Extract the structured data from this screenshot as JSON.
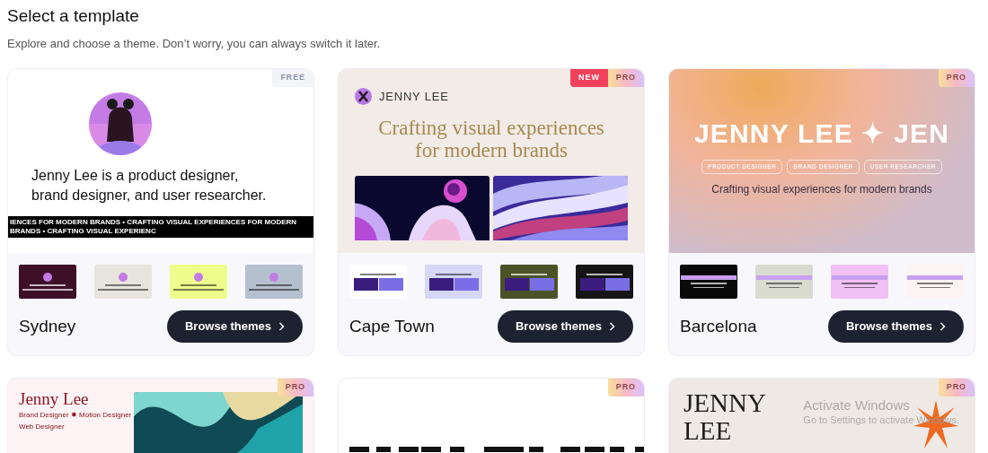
{
  "header": {
    "title": "Select a template",
    "subtitle": "Explore and choose a theme. Don’t worry, you can always switch it later."
  },
  "templates": [
    {
      "name": "Sydney",
      "button": "Browse themes",
      "badges": [
        {
          "label": "FREE",
          "kind": "free"
        }
      ],
      "preview": {
        "kind": "avatar_bio",
        "bio": "Jenny Lee is a product designer, brand designer, and user researcher.",
        "ticker": "IENCES FOR MODERN BRANDS • CRAFTING VISUAL EXPERIENCES FOR MODERN BRANDS • CRAFTING VISUAL EXPERIENC"
      },
      "variants": [
        {
          "color": "#3d1028"
        },
        {
          "color": "#e8e5de"
        },
        {
          "color": "#eefc8c"
        },
        {
          "color": "#b5c0cf"
        }
      ]
    },
    {
      "name": "Cape Town",
      "button": "Browse themes",
      "badges": [
        {
          "label": "NEW",
          "kind": "new"
        },
        {
          "label": "PRO",
          "kind": "pro"
        }
      ],
      "preview": {
        "kind": "headline_gallery",
        "brand": "JENNY LEE",
        "headline": "Crafting visual experiences for modern brands"
      },
      "variants": [
        {
          "color": "#ffffff"
        },
        {
          "color": "#d6d6f5"
        },
        {
          "color": "#4b5228"
        },
        {
          "color": "#151515"
        }
      ]
    },
    {
      "name": "Barcelona",
      "button": "Browse themes",
      "badges": [
        {
          "label": "PRO",
          "kind": "pro"
        }
      ],
      "preview": {
        "kind": "gradient_hero",
        "wordmark": "JENNY LEE ✦ JEN",
        "chips": [
          "PRODUCT DESIGNER",
          "BRAND DESIGNER",
          "USER RESEARCHER"
        ],
        "tagline": "Crafting visual experiences for modern brands"
      },
      "variants": [
        {
          "color": "#0a0a0a"
        },
        {
          "color": "#d9dbd0"
        },
        {
          "color": "#f0c0f5"
        },
        {
          "color": "#fbf4f2"
        }
      ]
    },
    {
      "badges": [
        {
          "label": "PRO",
          "kind": "pro"
        }
      ],
      "preview": {
        "kind": "name_roles",
        "name": "Jenny Lee",
        "roles": [
          "Brand Designer ✸ Motion Designer",
          "Web Designer"
        ]
      }
    },
    {
      "badges": [
        {
          "label": "PRO",
          "kind": "pro"
        }
      ],
      "preview": {
        "kind": "cropped_headline"
      }
    },
    {
      "badges": [
        {
          "label": "PRO",
          "kind": "pro"
        }
      ],
      "preview": {
        "kind": "serif_name",
        "name_lines": [
          "JENNY",
          "LEE"
        ]
      }
    }
  ],
  "system_notice": {
    "title": "Activate Windows",
    "hint": "Go to Settings to activate Windows."
  }
}
